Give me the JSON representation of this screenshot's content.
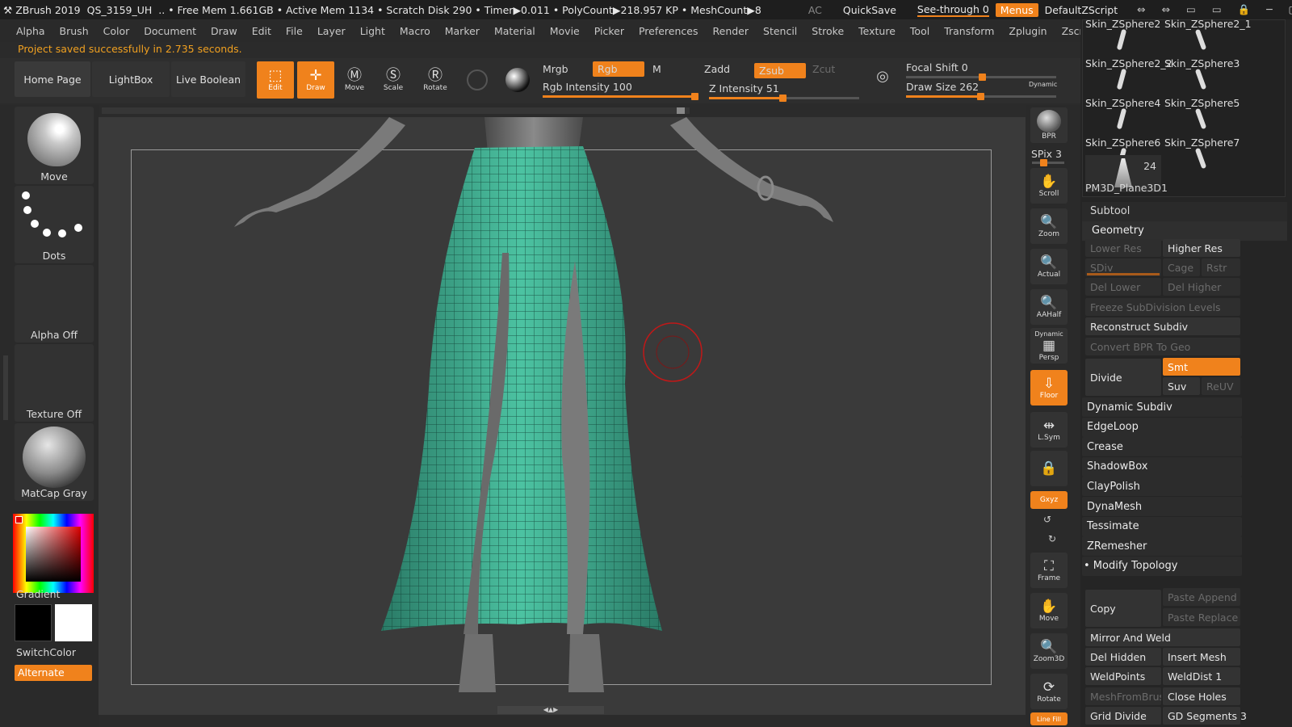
{
  "titlebar": {
    "app": "ZBrush 2019",
    "doc": "QS_3159_UH",
    "stats": ".. • Free Mem 1.661GB • Active Mem 1134 • Scratch Disk 290 •  Timer▶0.011 • PolyCount▶218.957 KP  • MeshCount▶8",
    "ac": "AC",
    "quicksave": "QuickSave",
    "seethrough": "See-through  0",
    "menus": "Menus",
    "script": "DefaultZScript"
  },
  "menubar": [
    "Alpha",
    "Brush",
    "Color",
    "Document",
    "Draw",
    "Edit",
    "File",
    "Layer",
    "Light",
    "Macro",
    "Marker",
    "Material",
    "Movie",
    "Picker",
    "Preferences",
    "Render",
    "Stencil",
    "Stroke",
    "Texture",
    "Tool",
    "Transform",
    "Zplugin",
    "Zscript"
  ],
  "status": "Project saved successfully in 2.735 seconds.",
  "toolbar": {
    "home": "Home Page",
    "lightbox": "LightBox",
    "liveboolean": "Live Boolean",
    "edit": "Edit",
    "draw": "Draw",
    "move": "Move",
    "scale": "Scale",
    "rotate": "Rotate",
    "mrgb": "Mrgb",
    "rgb": "Rgb",
    "m": "M",
    "rgb_intensity": "Rgb Intensity 100",
    "rgb_intensity_value": 100,
    "zadd": "Zadd",
    "zsub": "Zsub",
    "zcut": "Zcut",
    "z_intensity": "Z Intensity 51",
    "z_intensity_value": 51,
    "focal": "Focal Shift 0",
    "draw_size": "Draw Size 262",
    "dynamic": "Dynamic"
  },
  "leftpanel": {
    "brush": "Move",
    "stroke": "Dots",
    "alpha": "Alpha Off",
    "texture": "Texture Off",
    "material": "MatCap Gray",
    "gradient": "Gradient",
    "switch": "SwitchColor",
    "alternate": "Alternate"
  },
  "rightshelf": {
    "bpr": "BPR",
    "spix": "SPix 3",
    "scroll": "Scroll",
    "zoom": "Zoom",
    "actual": "Actual",
    "aahalf": "AAHalf",
    "dynamic": "Dynamic",
    "persp": "Persp",
    "floor": "Floor",
    "lsym": "L.Sym",
    "xyz": "Gxyz",
    "frame": "Frame",
    "move": "Move",
    "zoom3d": "Zoom3D",
    "rotate": "Rotate",
    "linefill": "Line Fill"
  },
  "subtools": [
    "Skin_ZSphere2",
    "Skin_ZSphere2_1",
    "Skin_ZSphere2_2",
    "Skin_ZSphere3",
    "Skin_ZSphere4",
    "Skin_ZSphere5",
    "Skin_ZSphere6",
    "Skin_ZSphere7"
  ],
  "plane": {
    "name": "PM3D_Plane3D1",
    "count": "24"
  },
  "panel": {
    "subtool": "Subtool",
    "geometry": "Geometry",
    "lower_res": "Lower Res",
    "higher_res": "Higher Res",
    "sdiv": "SDiv",
    "cage": "Cage",
    "rstr": "Rstr",
    "del_lower": "Del Lower",
    "del_higher": "Del Higher",
    "freeze": "Freeze SubDivision Levels",
    "reconstruct": "Reconstruct Subdiv",
    "convert": "Convert BPR To Geo",
    "divide": "Divide",
    "smt": "Smt",
    "suv": "Suv",
    "reuv": "ReUV",
    "sections": [
      "Dynamic Subdiv",
      "EdgeLoop",
      "Crease",
      "ShadowBox",
      "ClayPolish",
      "DynaMesh",
      "Tessimate",
      "ZRemesher",
      "Modify Topology"
    ],
    "copy": "Copy",
    "paste_append": "Paste Append",
    "paste_replace": "Paste Replace",
    "mirror_weld": "Mirror And Weld",
    "del_hidden": "Del Hidden",
    "insert_mesh": "Insert Mesh",
    "weldpoints": "WeldPoints",
    "welddist": "WeldDist 1",
    "meshfrombrush": "MeshFromBrush",
    "close_holes": "Close Holes",
    "grid_divide": "Grid Divide",
    "gd_segments": "GD Segments 3"
  },
  "colors": {
    "accent": "#f0821c",
    "skirt": "#3aa58a",
    "mesh": "#0f3a30"
  }
}
